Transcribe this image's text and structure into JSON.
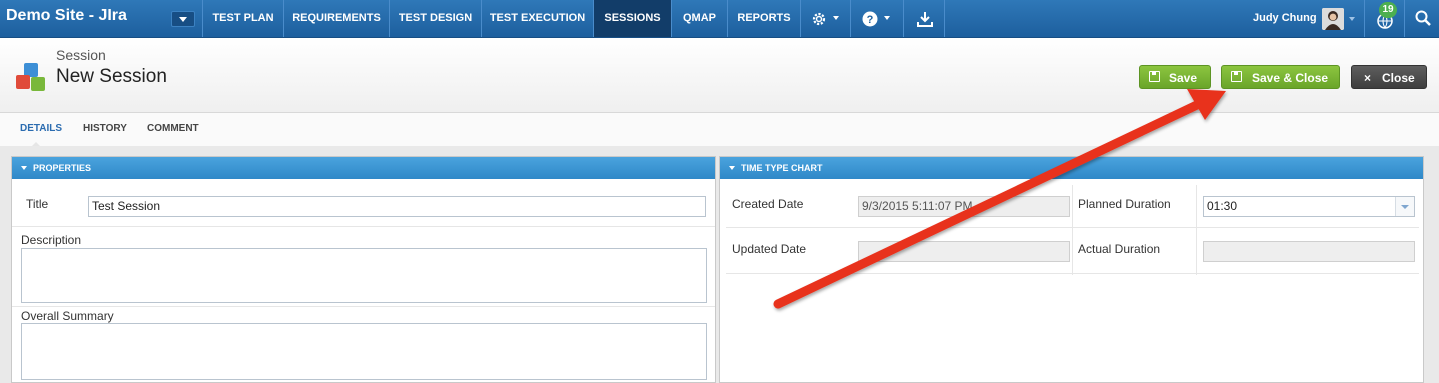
{
  "nav": {
    "site_title": "Demo Site - JIra",
    "items": [
      "TEST PLAN",
      "REQUIREMENTS",
      "TEST DESIGN",
      "TEST EXECUTION",
      "SESSIONS",
      "QMAP",
      "REPORTS"
    ],
    "active_item": "SESSIONS",
    "user_name": "Judy Chung",
    "notification_count": "19"
  },
  "header": {
    "breadcrumb": "Session",
    "title": "New Session",
    "save_label": "Save",
    "save_close_label": "Save & Close",
    "close_label": "Close"
  },
  "tabs": [
    "DETAILS",
    "HISTORY",
    "COMMENT"
  ],
  "properties": {
    "heading": "PROPERTIES",
    "title_label": "Title",
    "title_value": "Test Session",
    "description_label": "Description",
    "summary_label": "Overall Summary"
  },
  "time_chart": {
    "heading": "TIME TYPE CHART",
    "created_label": "Created Date",
    "created_value": "9/3/2015 5:11:07 PM",
    "updated_label": "Updated Date",
    "planned_label": "Planned Duration",
    "planned_value": "01:30",
    "actual_label": "Actual Duration"
  },
  "colors": {
    "nav_bg": "#1d5f9e",
    "panel_header": "#3a95d4",
    "save_green": "#7ab534",
    "close_dark": "#4a4a4a",
    "annotation_arrow": "#e8321f"
  }
}
